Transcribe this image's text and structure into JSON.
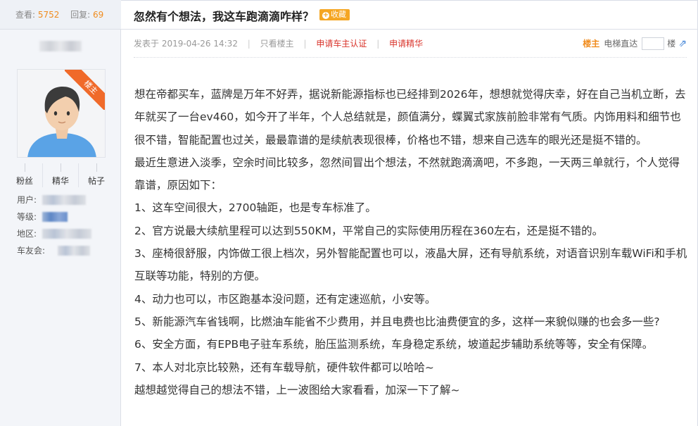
{
  "stats": {
    "views_label": "查看:",
    "views": "5752",
    "replies_label": "回复:",
    "replies": "69"
  },
  "author": {
    "badge": "楼主",
    "counts": [
      {
        "label": "粉丝"
      },
      {
        "label": "精华"
      },
      {
        "label": "帖子"
      }
    ],
    "fields": {
      "user_label": "用户:",
      "level_label": "等级:",
      "region_label": "地区:",
      "club_label": "车友会:"
    }
  },
  "post": {
    "title": "忽然有个想法，我这车跑滴滴咋样？",
    "favorite_label": "收藏",
    "posted_label": "发表于 2019-04-26 14:32",
    "only_owner": "只看楼主",
    "apply_cert": "申请车主认证",
    "apply_essence": "申请精华",
    "owner_tag": "楼主",
    "elevator": "电梯直达",
    "floor_suffix": "楼",
    "paragraphs": [
      "想在帝都买车，蓝牌是万年不好弄，据说新能源指标也已经排到2026年，想想就觉得庆幸，好在自己当机立断，去年就买了一台ev460，如今开了半年，个人总结就是，颜值满分，蝶翼式家族前脸非常有气质。内饰用料和细节也很不错，智能配置也过关，最最靠谱的是续航表现很棒，价格也不错，想来自己选车的眼光还是挺不错的。",
      "最近生意进入淡季，空余时间比较多，忽然间冒出个想法，不然就跑滴滴吧，不多跑，一天两三单就行，个人觉得靠谱，原因如下：",
      "1、这车空间很大，2700轴距，也是专车标准了。",
      "2、官方说最大续航里程可以达到550KM，平常自己的实际使用历程在360左右，还是挺不错的。",
      "3、座椅很舒服，内饰做工很上档次，另外智能配置也可以，液晶大屏，还有导航系统，对语音识别车载WiFi和手机互联等功能，特别的方便。",
      "4、动力也可以，市区跑基本没问题，还有定速巡航，小安等。",
      "5、新能源汽车省钱啊，比燃油车能省不少费用，并且电费也比油费便宜的多，这样一来貌似赚的也会多一些?",
      "6、安全方面，有EPB电子驻车系统，胎压监测系统，车身稳定系统，坡道起步辅助系统等等，安全有保障。",
      "7、本人对北京比较熟，还有车载导航，硬件软件都可以哈哈~",
      "越想越觉得自己的想法不错，上一波图给大家看看，加深一下了解~"
    ]
  },
  "colors": {
    "accent_orange": "#f08c1e",
    "link_red": "#d9342b",
    "badge_orange": "#f06a2a"
  }
}
